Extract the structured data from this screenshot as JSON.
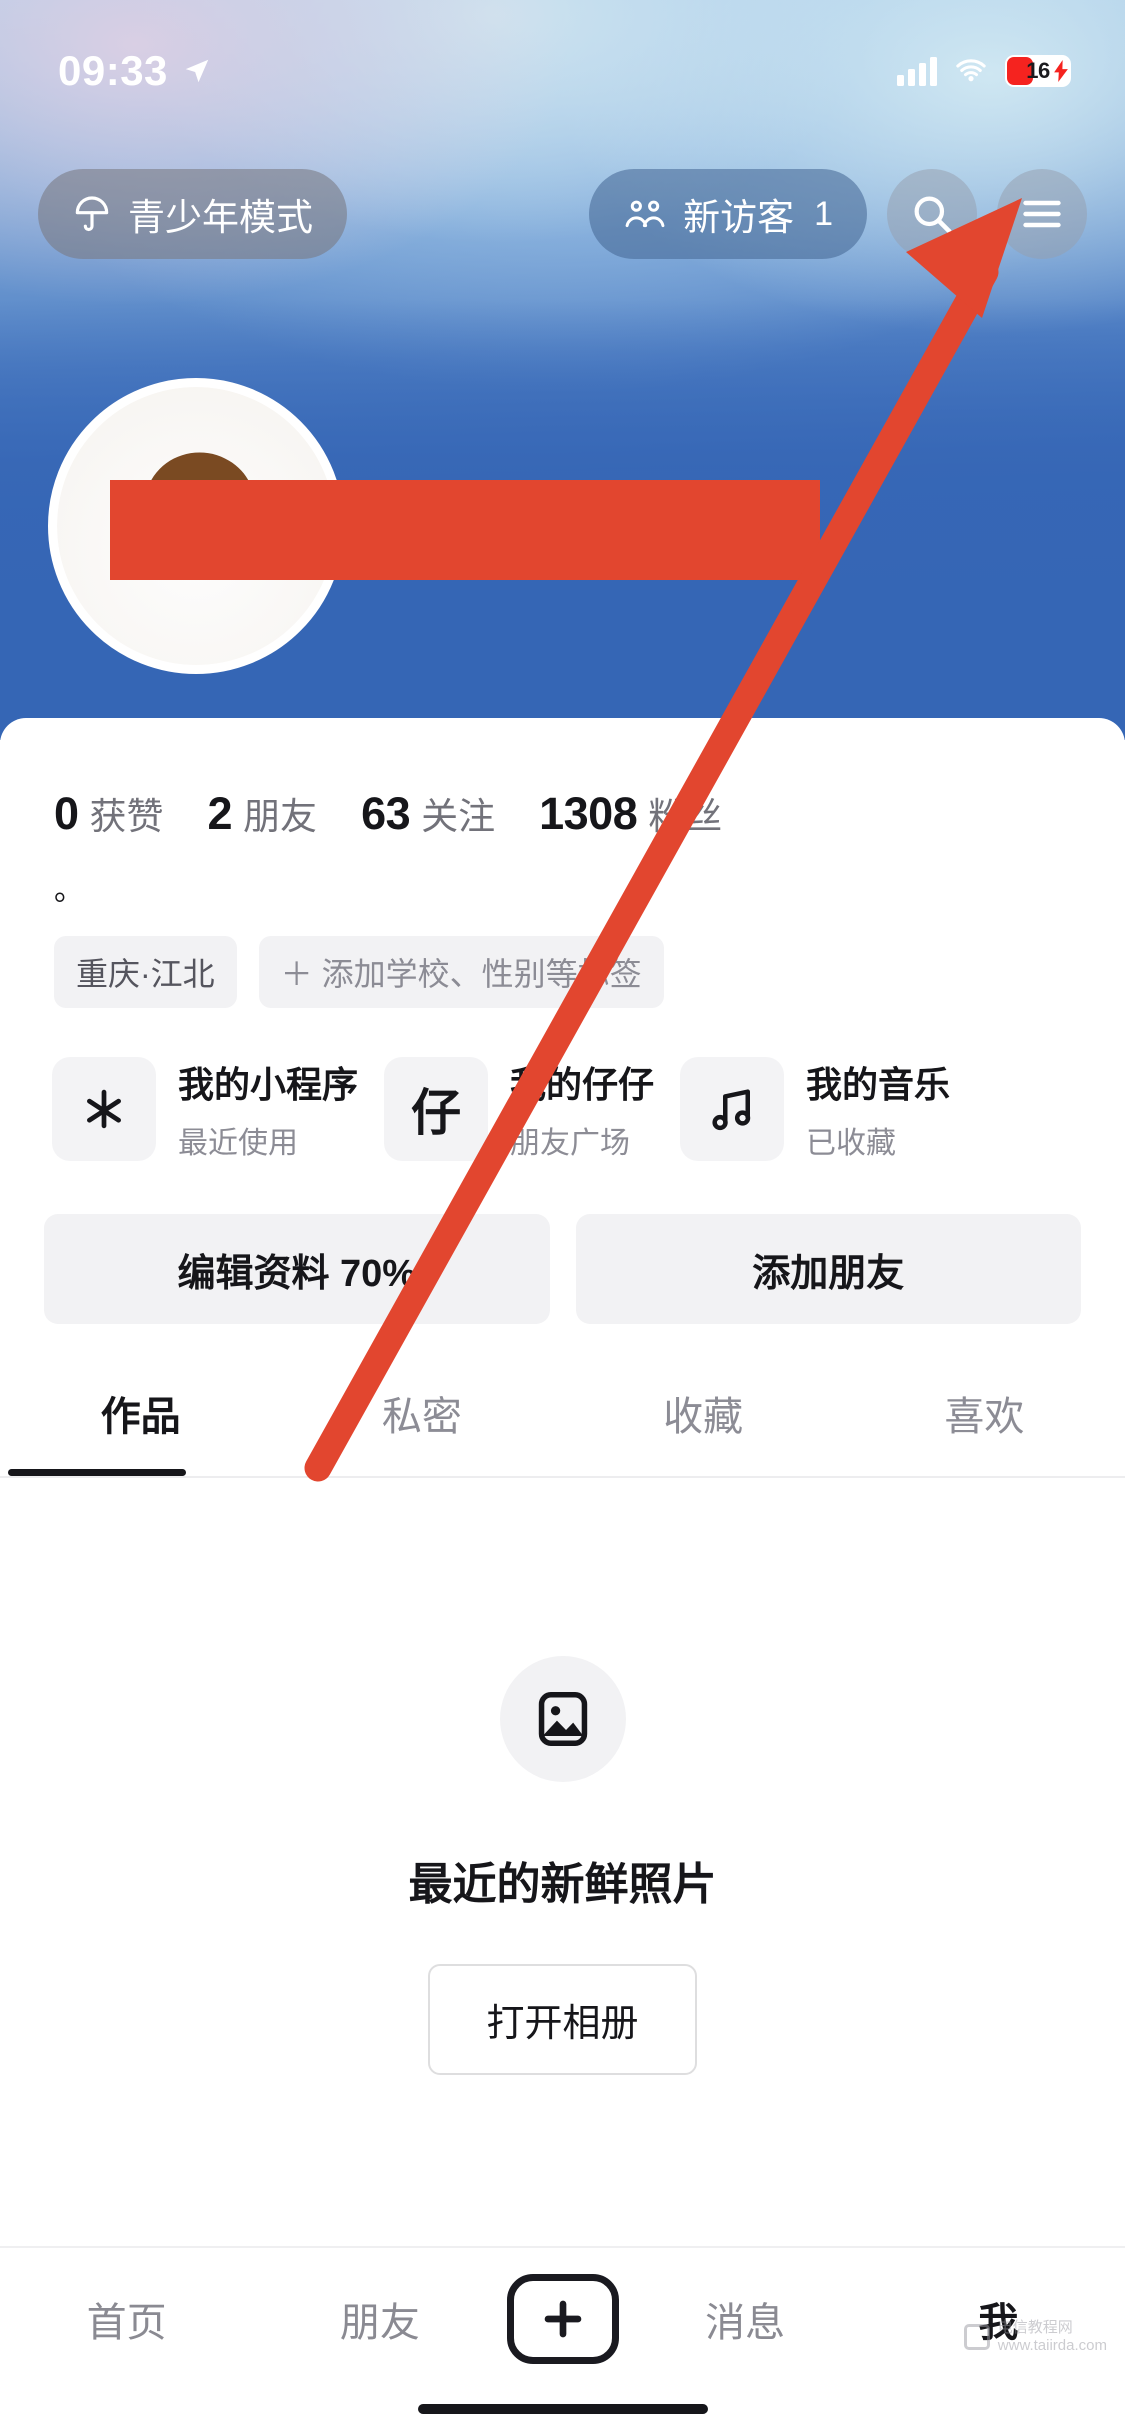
{
  "status_bar": {
    "time": "09:33",
    "location_icon": "location-arrow-icon",
    "signal_icon": "cellular-signal-icon",
    "wifi_icon": "wifi-icon",
    "battery_percent": "16",
    "battery_charging_icon": "lightning-bolt-icon"
  },
  "header": {
    "teen_mode_label": "青少年模式",
    "teen_mode_icon": "umbrella-icon",
    "visitor_label": "新访客",
    "visitor_count": "1",
    "visitor_icon": "friends-icon",
    "search_icon": "search-icon",
    "menu_icon": "hamburger-menu-icon"
  },
  "profile": {
    "avatar_name": "avatar",
    "username_redacted": "",
    "stats": [
      {
        "num": "0",
        "label": "获赞"
      },
      {
        "num": "2",
        "label": "朋友"
      },
      {
        "num": "63",
        "label": "关注"
      },
      {
        "num": "1308",
        "label": "粉丝"
      }
    ],
    "bio": "。",
    "tags": [
      {
        "text": "重庆·江北",
        "type": "location"
      },
      {
        "text": "＋ 添加学校、性别等标签",
        "type": "add"
      }
    ]
  },
  "quick_cards": [
    {
      "icon": "mini-program-icon",
      "icon_glyph": "米",
      "title": "我的小程序",
      "subtitle": "最近使用"
    },
    {
      "icon": "zaizai-icon",
      "icon_glyph": "仔",
      "title": "我的仔仔",
      "subtitle": "朋友广场"
    },
    {
      "icon": "music-note-icon",
      "icon_glyph": "♫",
      "title": "我的音乐",
      "subtitle": "已收藏"
    }
  ],
  "actions": [
    {
      "label": "编辑资料 70%",
      "name": "edit-profile-button"
    },
    {
      "label": "添加朋友",
      "name": "add-friend-button"
    }
  ],
  "tabs": [
    {
      "label": "作品",
      "active": true
    },
    {
      "label": "私密",
      "active": false
    },
    {
      "label": "收藏",
      "active": false
    },
    {
      "label": "喜欢",
      "active": false
    }
  ],
  "empty_state": {
    "icon": "photo-placeholder-icon",
    "title": "最近的新鲜照片",
    "button_label": "打开相册"
  },
  "bottom_nav": [
    {
      "label": "首页",
      "active": false
    },
    {
      "label": "朋友",
      "active": false
    },
    {
      "label": "消息",
      "active": false
    },
    {
      "label": "我",
      "active": true
    }
  ],
  "bottom_nav_center": {
    "icon": "plus-icon"
  },
  "annotation": {
    "arrow_color": "#e2462f",
    "arrow_target": "hamburger-menu-icon"
  },
  "watermark": {
    "line1": "电信教程网",
    "line2": "www.taiirda.com"
  }
}
